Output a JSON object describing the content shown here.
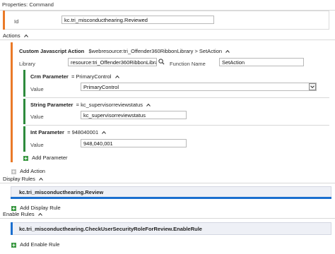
{
  "header": {
    "title": "Properties: Command"
  },
  "id_field": {
    "label": "Id",
    "value": "kc.tri_misconducthearing.Reviewed"
  },
  "actions": {
    "section_label": "Actions",
    "custom_action": {
      "title": "Custom Javascript Action",
      "path": "$webresource:tri_Offender360RibbonLibrary > SetAction",
      "library_label": "Library",
      "library_value": "resource:tri_Offender360RibbonLibrary",
      "function_label": "Function Name",
      "function_value": "SetAction"
    },
    "parameters": [
      {
        "type_label": "Crm Parameter",
        "eq_text": "= PrimaryControl",
        "value_label": "Value",
        "value": "PrimaryControl"
      },
      {
        "type_label": "String Parameter",
        "eq_text": "= kc_supervisorreviewstatus",
        "value_label": "Value",
        "value": "kc_supervisorreviewstatus"
      },
      {
        "type_label": "Int Parameter",
        "eq_text": "= 948040001",
        "value_label": "Value",
        "value": "948,040,001"
      }
    ],
    "add_parameter_label": "Add Parameter",
    "add_action_label": "Add Action"
  },
  "display_rules": {
    "section_label": "Display Rules",
    "rule": "kc.tri_misconducthearing.Review",
    "add_label": "Add Display Rule"
  },
  "enable_rules": {
    "section_label": "Enable Rules",
    "rule": "kc.tri_misconducthearing.CheckUserSecurityRoleForReview.EnableRule",
    "add_label": "Add Enable Rule"
  },
  "colors": {
    "orange": "#ea7a28",
    "green": "#2e8b3c",
    "blue": "#1b6fcf"
  }
}
